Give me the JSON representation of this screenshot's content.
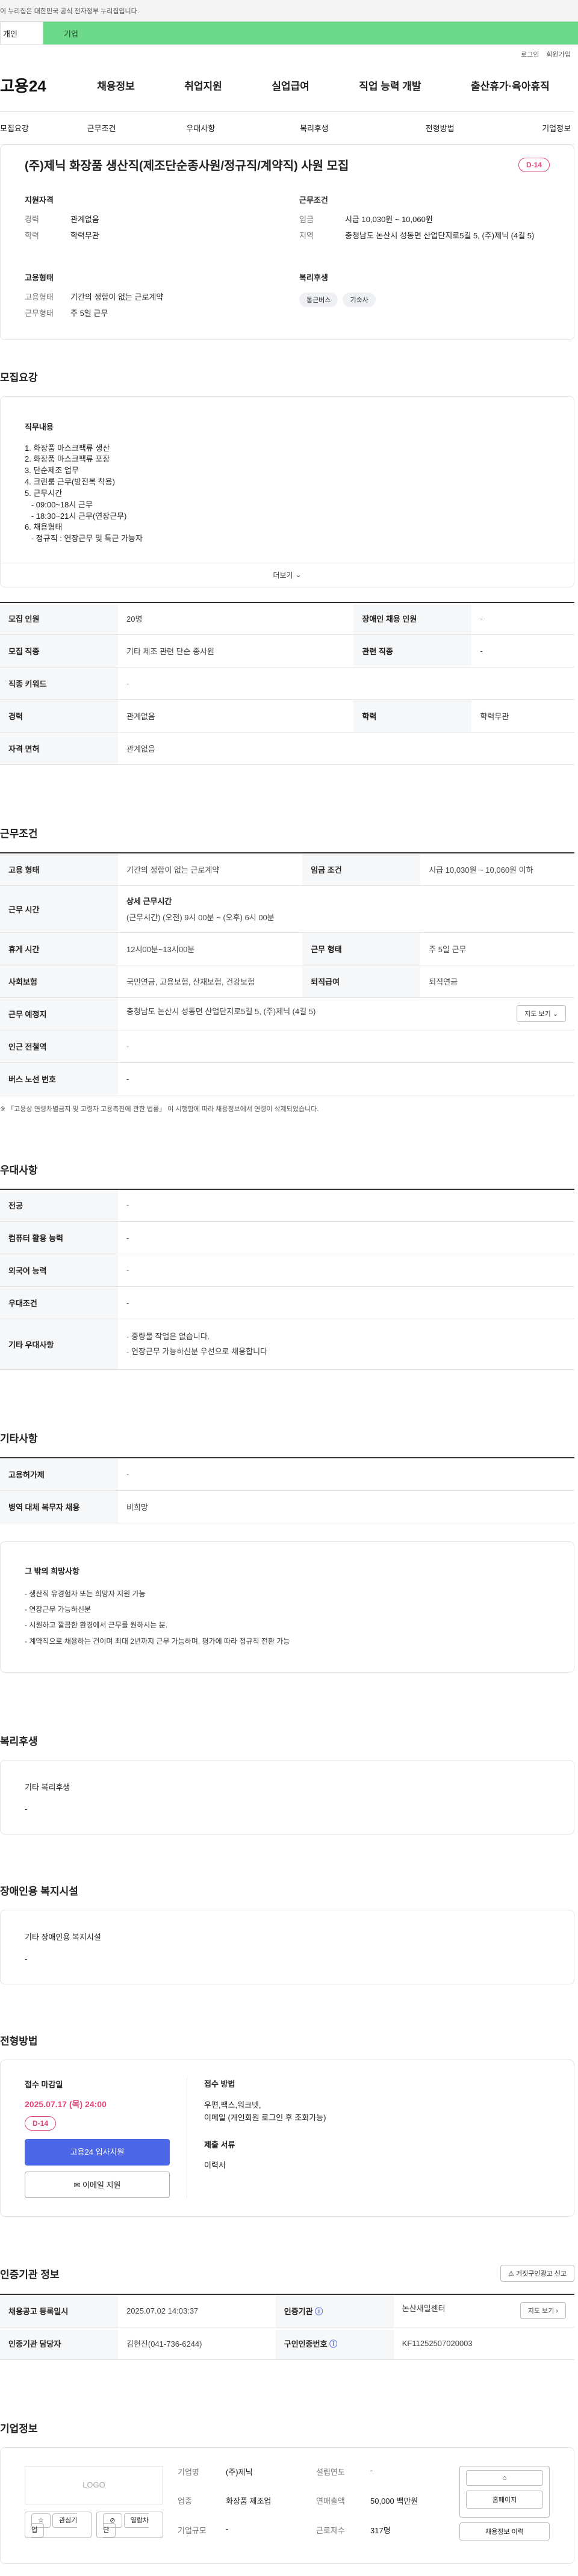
{
  "gov_notice": "이 누리집은 대한민국 공식 전자정부 누리집입니다.",
  "tabs": [
    "개인",
    "기업"
  ],
  "util": [
    "로그인",
    "회원가입"
  ],
  "logo": "고용24",
  "gnb": [
    "채용정보",
    "취업지원",
    "실업급여",
    "직업 능력 개발",
    "출산휴가·육아휴직"
  ],
  "subnav": [
    "모집요강",
    "근무조건",
    "우대사항",
    "복리후생",
    "전형방법",
    "기업정보"
  ],
  "job": {
    "title": "(주)제닉 화장품 생산직(제조단순종사원/정규직/계약직) 사원 모집",
    "dday": "D-14"
  },
  "summary": {
    "qual_title": "지원자격",
    "career_k": "경력",
    "career_v": "관계없음",
    "edu_k": "학력",
    "edu_v": "학력무관",
    "cond_title": "근무조건",
    "wage_k": "임금",
    "wage_v": "시급 10,030원 ~ 10,060원",
    "area_k": "지역",
    "area_v": "충청남도 논산시 성동면 산업단지로5길 5, (주)제닉 (4길 5)",
    "emp_title": "고용형태",
    "emptype_k": "고용형태",
    "emptype_v": "기간의 정함이 없는 근로계약",
    "worktype_k": "근무형태",
    "worktype_v": "주 5일 근무",
    "welfare_title": "복리후생",
    "chips": [
      "통근버스",
      "기숙사"
    ]
  },
  "recruit": {
    "title": "모집요강",
    "duty_title": "직무내용",
    "duty_text": "1. 화장품 마스크팩류 생산\n2. 화장품 마스크팩류 포장\n3. 단순제조 업무\n4. 크린룸 근무(방진복 착용)\n5. 근무시간\n   - 09:00~18시 근무\n   - 18:30~21시 근무(연장근무)\n6. 채용형태\n   - 정규직 : 연장근무 및 특근 가능자",
    "more": "더보기",
    "rows": [
      {
        "k1": "모집 인원",
        "v1": "20명",
        "k2": "장애인 채용 인원",
        "v2": "-"
      },
      {
        "k1": "모집 직종",
        "v1": "기타 제조 관련 단순 종사원",
        "k2": "관련 직종",
        "v2": "-"
      },
      {
        "k1": "직종 키워드",
        "v1": "-"
      },
      {
        "k1": "경력",
        "v1": "관계없음",
        "k2": "학력",
        "v2": "학력무관"
      },
      {
        "k1": "자격 면허",
        "v1": "관계없음"
      }
    ]
  },
  "work": {
    "title": "근무조건",
    "emp_k": "고용 형태",
    "emp_v": "기간의 정함이 없는 근로계약",
    "wage_k": "임금 조건",
    "wage_v": "시급 10,030원 ~ 10,060원 이하",
    "time_k": "근무 시간",
    "time_sub": "상세 근무시간",
    "time_v": "(근무시간) (오전) 9시 00분 ~ (오후) 6시 00분",
    "break_k": "휴게 시간",
    "break_v": "12시00분~13시00분",
    "form_k": "근무 형태",
    "form_v": "주 5일 근무",
    "ins_k": "사회보험",
    "ins_v": "국민연금, 고용보험, 산재보험, 건강보험",
    "ret_k": "퇴직급여",
    "ret_v": "퇴직연금",
    "place_k": "근무 예정지",
    "place_v": "충청남도 논산시 성동면 산업단지로5길 5, (주)제닉 (4길 5)",
    "map_btn": "지도 보기",
    "subway_k": "인근 전철역",
    "subway_v": "-",
    "bus_k": "버스 노선 번호",
    "bus_v": "-",
    "note": "※ 「고용상 연령차별금지 및 고령자 고용촉진에 관한 법률」 이 시행함에 따라 채용정보에서 연령이 삭제되었습니다."
  },
  "pref": {
    "title": "우대사항",
    "rows": [
      {
        "k": "전공",
        "v": "-"
      },
      {
        "k": "컴퓨터 활용 능력",
        "v": "-"
      },
      {
        "k": "외국어 능력",
        "v": "-"
      },
      {
        "k": "우대조건",
        "v": "-"
      }
    ],
    "etc_k": "기타 우대사항",
    "etc_lines": [
      "- 중량물 작업은 없습니다.",
      "- 연장근무 가능하신분 우선으로 채용합니다"
    ]
  },
  "other": {
    "title": "기타사항",
    "rows": [
      {
        "k": "고용허가제",
        "v": "-"
      },
      {
        "k": "병역 대체 복무자 채용",
        "v": "비희망"
      }
    ],
    "hope_title": "그 밖의 희망사항",
    "hope_lines": [
      "- 생산직 유경험자 또는 희망자 지원 가능",
      "- 연장근무 가능하신분",
      "- 시원하고 깔끔한 환경에서 근무를 원하시는 분.",
      "- 계약직으로 채용하는 건이며 최대 2년까지 근무 가능하며, 평가에 따라 정규직 전환 가능"
    ]
  },
  "welfare": {
    "title": "복리후생",
    "sub": "기타 복리후생",
    "v": "-"
  },
  "disabled": {
    "title": "장애인용 복지시설",
    "sub": "기타 장애인용 복지시설",
    "v": "-"
  },
  "apply": {
    "title": "전형방법",
    "deadline_title": "접수 마감일",
    "deadline": "2025.07.17 (목) 24:00",
    "dday": "D-14",
    "btn1": "고용24 입사지원",
    "btn2": "이메일 지원",
    "method_title": "접수 방법",
    "method_lines": [
      "우편,팩스,워크넷,",
      "이메일 (개인회원 로그인 후 조회가능)"
    ],
    "docs_title": "제출 서류",
    "docs_v": "이력서"
  },
  "org": {
    "title": "인증기관 정보",
    "report_btn": "거짓구인광고 신고",
    "reg_k": "채용공고 등록일시",
    "reg_v": "2025.07.02 14:03:37",
    "center_k": "인증기관",
    "center_v": "논산새일센터",
    "map_btn": "지도 보기",
    "mgr_k": "인증기관 담당자",
    "mgr_v": "김현진(041-736-6244)",
    "cert_k": "구인인증번호",
    "cert_v": "KF11252507020003"
  },
  "company": {
    "title": "기업정보",
    "logo": "LOGO",
    "btn_fav": "관심기업",
    "btn_block": "열람차단",
    "name_k": "기업명",
    "name_v": "(주)제닉",
    "year_k": "설립연도",
    "year_v": "-",
    "ind_k": "업종",
    "ind_v": "화장품 제조업",
    "sales_k": "연매출액",
    "sales_v": "50,000 백만원",
    "scale_k": "기업규모",
    "scale_v": "-",
    "emp_k": "근로자수",
    "emp_v": "317명",
    "btn_home": "홈페이지",
    "btn_jobs": "채용정보 이력"
  }
}
